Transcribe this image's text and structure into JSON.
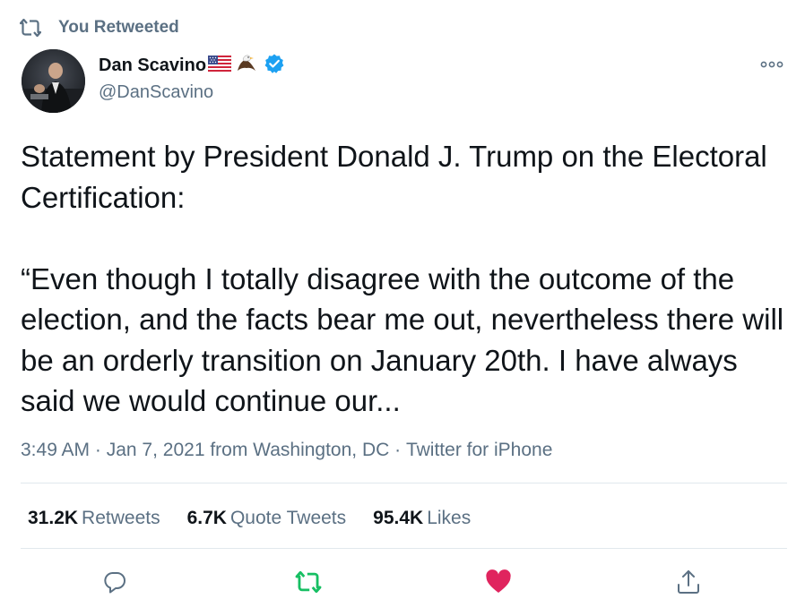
{
  "retweet_header": {
    "text": "You Retweeted",
    "icon": "retweet-icon"
  },
  "author": {
    "display_name": "Dan Scavino",
    "emojis": [
      "us-flag",
      "eagle"
    ],
    "verified": true,
    "handle": "@DanScavino"
  },
  "tweet": {
    "paragraphs": [
      "Statement by President Donald J. Trump on the Electoral Certification:",
      "“Even though I totally disagree with the outcome of the election, and the facts bear me out, nevertheless there will be an orderly transition on January 20th. I have always said we would continue our..."
    ]
  },
  "meta": {
    "time": "3:49 AM",
    "sep1": " · ",
    "date": "Jan 7, 2021",
    "location": " from Washington, DC",
    "sep2": " · ",
    "source": "Twitter for iPhone"
  },
  "stats": {
    "retweets": {
      "count": "31.2K",
      "label": "Retweets"
    },
    "quotes": {
      "count": "6.7K",
      "label": "Quote Tweets"
    },
    "likes": {
      "count": "95.4K",
      "label": "Likes"
    }
  },
  "actions": {
    "reply_icon": "reply-icon",
    "retweet_icon": "retweet-icon",
    "like_icon": "heart-icon",
    "share_icon": "share-icon",
    "retweeted": true,
    "liked": true
  },
  "colors": {
    "text": "#0f1419",
    "secondary": "#5b7083",
    "verified": "#1da1f2",
    "retweet_green": "#17bf63",
    "like_red": "#e0245e",
    "divider": "#e1e8ed"
  }
}
